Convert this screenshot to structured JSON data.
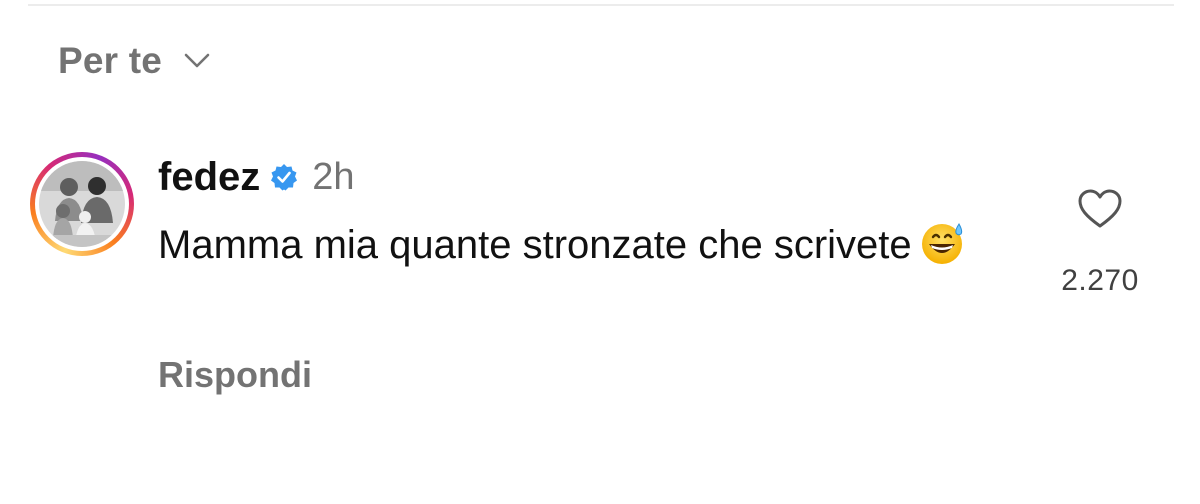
{
  "sort": {
    "label": "Per te",
    "icon": "chevron-down-icon"
  },
  "comment": {
    "username": "fedez",
    "verified": true,
    "verified_color": "#3797f0",
    "timestamp": "2h",
    "text": "Mamma mia quante stronzate che scrivete",
    "emoji": "grinning-face-with-sweat-icon",
    "reply_label": "Rispondi",
    "like_count": "2.270",
    "like_icon": "heart-outline-icon"
  },
  "colors": {
    "secondary_text": "#737373",
    "primary_text": "#111111",
    "story_ring": [
      "#feda75",
      "#fa7e1e",
      "#d62976",
      "#962fbf"
    ]
  }
}
